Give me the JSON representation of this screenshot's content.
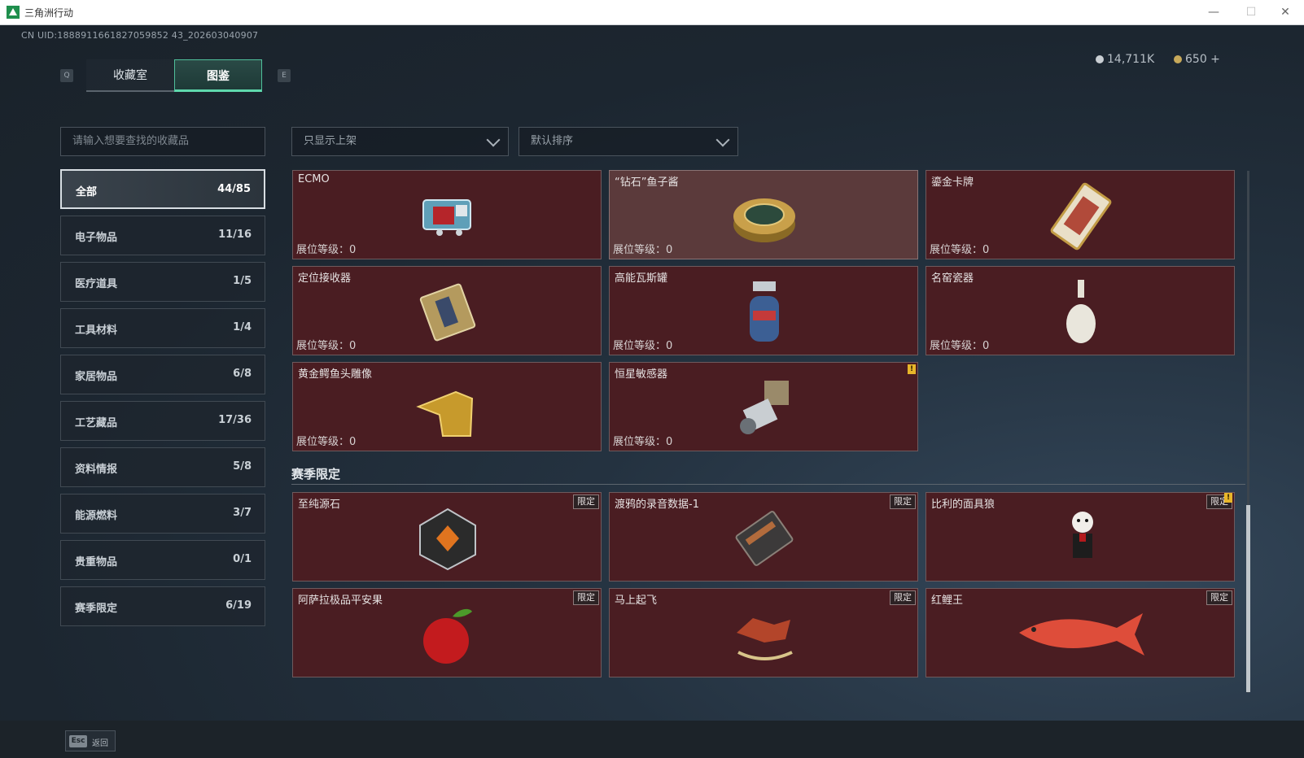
{
  "window": {
    "title": "三角洲行动"
  },
  "header": {
    "uid": "CN UID:1888911661827059852 43_202603040907",
    "tab_prev_key": "Q",
    "tab_next_key": "E",
    "tabs": [
      {
        "label": "收藏室"
      },
      {
        "label": "图鉴"
      }
    ],
    "currency": [
      {
        "value": "14,711K"
      },
      {
        "value": "650 +"
      }
    ]
  },
  "sidebar": {
    "search_placeholder": "请输入想要查找的收藏品",
    "categories": [
      {
        "label": "全部",
        "count": "44/85"
      },
      {
        "label": "电子物品",
        "count": "11/16"
      },
      {
        "label": "医疗道具",
        "count": "1/5"
      },
      {
        "label": "工具材料",
        "count": "1/4"
      },
      {
        "label": "家居物品",
        "count": "6/8"
      },
      {
        "label": "工艺藏品",
        "count": "17/36"
      },
      {
        "label": "资料情报",
        "count": "5/8"
      },
      {
        "label": "能源燃料",
        "count": "3/7"
      },
      {
        "label": "贵重物品",
        "count": "0/1"
      },
      {
        "label": "赛季限定",
        "count": "6/19"
      }
    ]
  },
  "filters": {
    "shelf": "只显示上架",
    "sort": "默认排序"
  },
  "items": [
    {
      "name": "ECMO",
      "level": "展位等级：0",
      "icon": "ecmo-machine"
    },
    {
      "name": "“钻石”鱼子酱",
      "level": "展位等级：0",
      "icon": "caviar-tin"
    },
    {
      "name": "鎏金卡牌",
      "level": "展位等级：0",
      "icon": "gilded-card"
    },
    {
      "name": "定位接收器",
      "level": "展位等级：0",
      "icon": "receiver"
    },
    {
      "name": "高能瓦斯罐",
      "level": "展位等级：0",
      "icon": "gas-canister"
    },
    {
      "name": "名窑瓷器",
      "level": "展位等级：0",
      "icon": "porcelain-vase"
    },
    {
      "name": "黄金鳄鱼头雕像",
      "level": "展位等级：0",
      "icon": "gold-crocodile"
    },
    {
      "name": "恒星敏感器",
      "level": "展位等级：0",
      "icon": "star-sensor",
      "warn": "!"
    }
  ],
  "season": {
    "title": "赛季限定",
    "items": [
      {
        "name": "至纯源石",
        "badge": "限定",
        "icon": "source-stone"
      },
      {
        "name": "渡鸦的录音数据-1",
        "badge": "限定",
        "icon": "recorder"
      },
      {
        "name": "比利的面具狼",
        "badge": "限定",
        "icon": "billy-puppet",
        "warn": "!"
      },
      {
        "name": "阿萨拉极品平安果",
        "badge": "限定",
        "icon": "apple"
      },
      {
        "name": "马上起飞",
        "badge": "限定",
        "icon": "rocking-horse"
      },
      {
        "name": "红鲤王",
        "badge": "限定",
        "icon": "red-carp"
      }
    ]
  },
  "footer": {
    "esc_key": "Esc",
    "esc_label": "返回"
  }
}
